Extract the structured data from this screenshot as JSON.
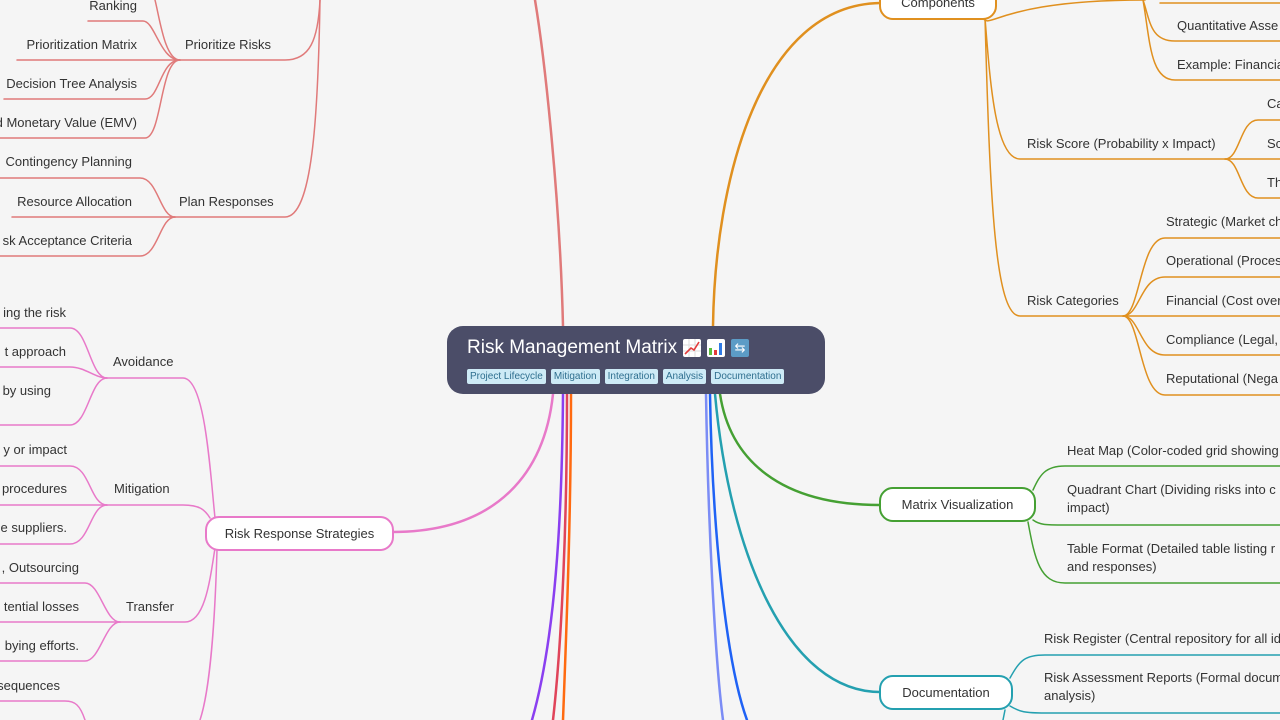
{
  "root": {
    "title": "Risk Management Matrix",
    "emoji_icons": [
      "chart-increasing-icon",
      "bar-chart-icon",
      "repeat-arrows-icon"
    ],
    "tags": [
      "Project Lifecycle",
      "Mitigation",
      "Integration",
      "Analysis",
      "Documentation"
    ]
  },
  "colors": {
    "background": "#f5f5f5",
    "root_fill": "#4b4d68",
    "tag_fill": "#cdeaf6",
    "branch_red": "#e07a7a",
    "branch_pink": "#e879c9",
    "branch_orange": "#e0901f",
    "branch_green": "#45a033",
    "branch_teal": "#24a0b0",
    "branch_purple": "#8a3ff0",
    "branch_crimson": "#e0445a",
    "branch_deep_orange": "#ff6a10",
    "branch_periwinkle": "#7b8cf5",
    "branch_blue": "#1f62f5"
  },
  "left": {
    "prioritize": {
      "label": "Prioritize Risks",
      "children": [
        "Ranking",
        "Prioritization Matrix",
        "Decision Tree Analysis",
        "d Monetary Value (EMV)"
      ]
    },
    "plan": {
      "label": "Plan Responses",
      "children": [
        "Contingency Planning",
        "Resource Allocation",
        "sk Acceptance Criteria"
      ]
    },
    "strategies": {
      "label": "Risk Response Strategies",
      "avoidance": {
        "label": "Avoidance",
        "children": [
          "ing the risk",
          "t approach",
          "by using"
        ]
      },
      "mitigation": {
        "label": "Mitigation",
        "children": [
          "y or impact",
          "procedures",
          "e suppliers."
        ]
      },
      "transfer": {
        "label": "Transfer",
        "children": [
          ", Outsourcing",
          "tential losses",
          "bying efforts."
        ]
      },
      "more": {
        "children": [
          "sequences"
        ]
      }
    }
  },
  "right": {
    "components": {
      "label": "Components",
      "children_top": [
        "Quantitative Asse",
        "Example: Financia"
      ],
      "risk_score": {
        "label": "Risk Score (Probability x Impact)",
        "children": [
          "Ca",
          "Sc",
          "Th"
        ]
      },
      "risk_categories": {
        "label": "Risk Categories",
        "children": [
          "Strategic (Market ch",
          "Operational (Proces",
          "Financial (Cost over",
          "Compliance (Legal,",
          "Reputational (Nega"
        ]
      }
    },
    "visualization": {
      "label": "Matrix Visualization",
      "children": [
        "Heat Map (Color-coded grid showing",
        "Quadrant Chart (Dividing risks into c",
        "impact)",
        "Table Format (Detailed table listing r",
        "and responses)"
      ]
    },
    "documentation": {
      "label": "Documentation",
      "children": [
        "Risk Register (Central repository for all id",
        "Risk Assessment Reports (Formal docum",
        "analysis)"
      ]
    }
  }
}
